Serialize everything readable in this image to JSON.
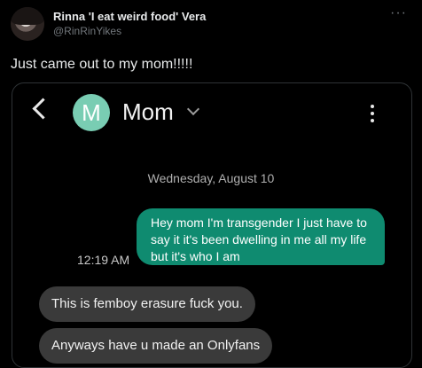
{
  "tweet": {
    "author_name": "Rinna 'I eat weird food' Vera",
    "handle": "@RinRinYikes",
    "more_label": "···",
    "text": "Just came out to my mom!!!!!"
  },
  "screenshot": {
    "contact": {
      "initial": "M",
      "name": "Mom",
      "avatar_color": "#79cdb3"
    },
    "date_header": "Wednesday, August 10",
    "messages": [
      {
        "direction": "sent",
        "text": "Hey mom I'm transgender I just have to say it it's been dwelling in me all my life but it's who I am",
        "time": "12:19 AM",
        "color": "#0f8b70"
      },
      {
        "direction": "received",
        "text": "This is femboy erasure fuck you.",
        "color": "#3a3a3a"
      },
      {
        "direction": "received",
        "text": "Anyways have u made an Onlyfans",
        "color": "#3a3a3a"
      }
    ]
  }
}
